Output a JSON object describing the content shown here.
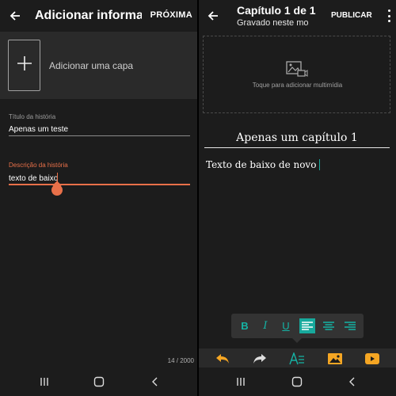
{
  "left": {
    "title": "Adicionar informaç…",
    "next_label": "PRÓXIMA",
    "cover_label": "Adicionar uma capa",
    "title_field": {
      "label": "Título da história",
      "value": "Apenas um teste"
    },
    "desc_field": {
      "label": "Descrição da história",
      "value": "texto de baixo"
    },
    "counter": "14 / 2000",
    "icons": {
      "back": "back-arrow-icon",
      "add": "plus-icon"
    }
  },
  "right": {
    "title": "Capítulo 1 de 1",
    "subtitle": "Gravado neste mo…",
    "publish_label": "PUBLICAR",
    "media_label": "Toque para adicionar multimídia",
    "chapter_title": "Apenas um capítulo 1",
    "body_text": "Texto de baixo de novo",
    "format_buttons": [
      "B",
      "I",
      "U"
    ],
    "colors": {
      "accent": "#17a99c",
      "orange": "#f5a623",
      "red": "#e87049"
    }
  },
  "nav": {
    "icons": [
      "recents-icon",
      "home-icon",
      "back-icon"
    ]
  }
}
